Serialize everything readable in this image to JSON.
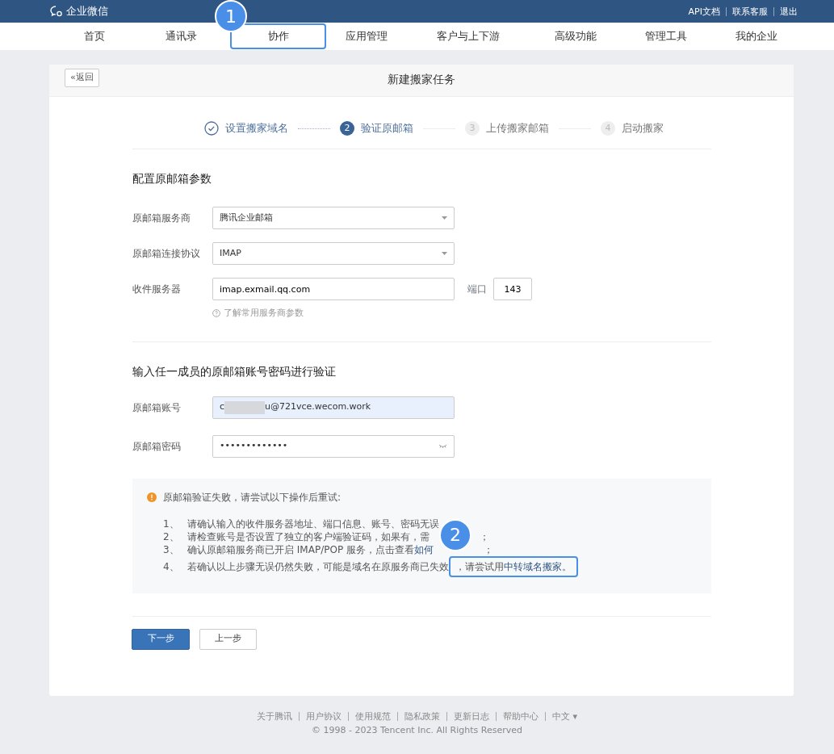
{
  "topbar": {
    "logo": "企业微信",
    "links": [
      "API文档",
      "联系客服",
      "退出"
    ]
  },
  "nav": [
    {
      "label": "首页",
      "highlighted": false
    },
    {
      "label": "通讯录",
      "highlighted": false
    },
    {
      "label": "协作",
      "highlighted": true
    },
    {
      "label": "应用管理",
      "highlighted": false
    },
    {
      "label": "客户与上下游",
      "highlighted": false
    },
    {
      "label": "高级功能",
      "highlighted": false
    },
    {
      "label": "管理工具",
      "highlighted": false
    },
    {
      "label": "我的企业",
      "highlighted": false
    }
  ],
  "annotations": [
    "1",
    "2"
  ],
  "card": {
    "back": "«返回",
    "title": "新建搬家任务"
  },
  "steps": [
    {
      "label": "设置搬家域名",
      "completed": true,
      "selected": false
    },
    {
      "num": "2",
      "label": "验证原邮箱",
      "completed": false,
      "selected": true
    },
    {
      "num": "3",
      "label": "上传搬家邮箱",
      "completed": false,
      "selected": false
    },
    {
      "num": "4",
      "label": "启动搬家",
      "completed": false,
      "selected": false
    }
  ],
  "section1": {
    "title": "配置原邮箱参数",
    "provider_label": "原邮箱服务商",
    "provider": "腾讯企业邮箱",
    "protocol_label": "原邮箱连接协议",
    "protocol": "IMAP",
    "server_label": "收件服务器",
    "server": "imap.exmail.qq.com",
    "port_label": "端口",
    "port": "143",
    "help": "了解常用服务商参数"
  },
  "section2": {
    "title": "输入任一成员的原邮箱账号密码进行验证",
    "account_label": "原邮箱账号",
    "account_prefix": "c",
    "account_suffix": "u@721vce.wecom.work",
    "password_label": "原邮箱密码",
    "password": "•••••••••••••"
  },
  "alert": {
    "title": "原邮箱验证失败，请尝试以下操作后重试:",
    "items": [
      {
        "num": "1、",
        "text": "请确认输入的收件服务器地址、端口信息、账号、密码无误"
      },
      {
        "num": "2、",
        "text": "请检查账号是否设置了独立的客户端验证码，如果有，需",
        "tail": "；"
      },
      {
        "num": "3、",
        "text": "确认原邮箱服务商已开启 IMAP/POP 服务，点击查看 ",
        "link": "如何",
        "tail": "；"
      },
      {
        "num": "4、",
        "text": "若确认以上步骤无误仍然失败，可能是域名在原服务商已失效",
        "boxed": "，请尝试用 ",
        "link": "中转域名搬家",
        "tail": " 。"
      }
    ]
  },
  "buttons": {
    "next": "下一步",
    "prev": "上一步"
  },
  "footer": {
    "links": [
      "关于腾讯",
      "用户协议",
      "使用规范",
      "隐私政策",
      "更新日志",
      "帮助中心",
      "中文 ▾"
    ],
    "copyright": "© 1998 - 2023 Tencent Inc. All Rights Reserved"
  }
}
